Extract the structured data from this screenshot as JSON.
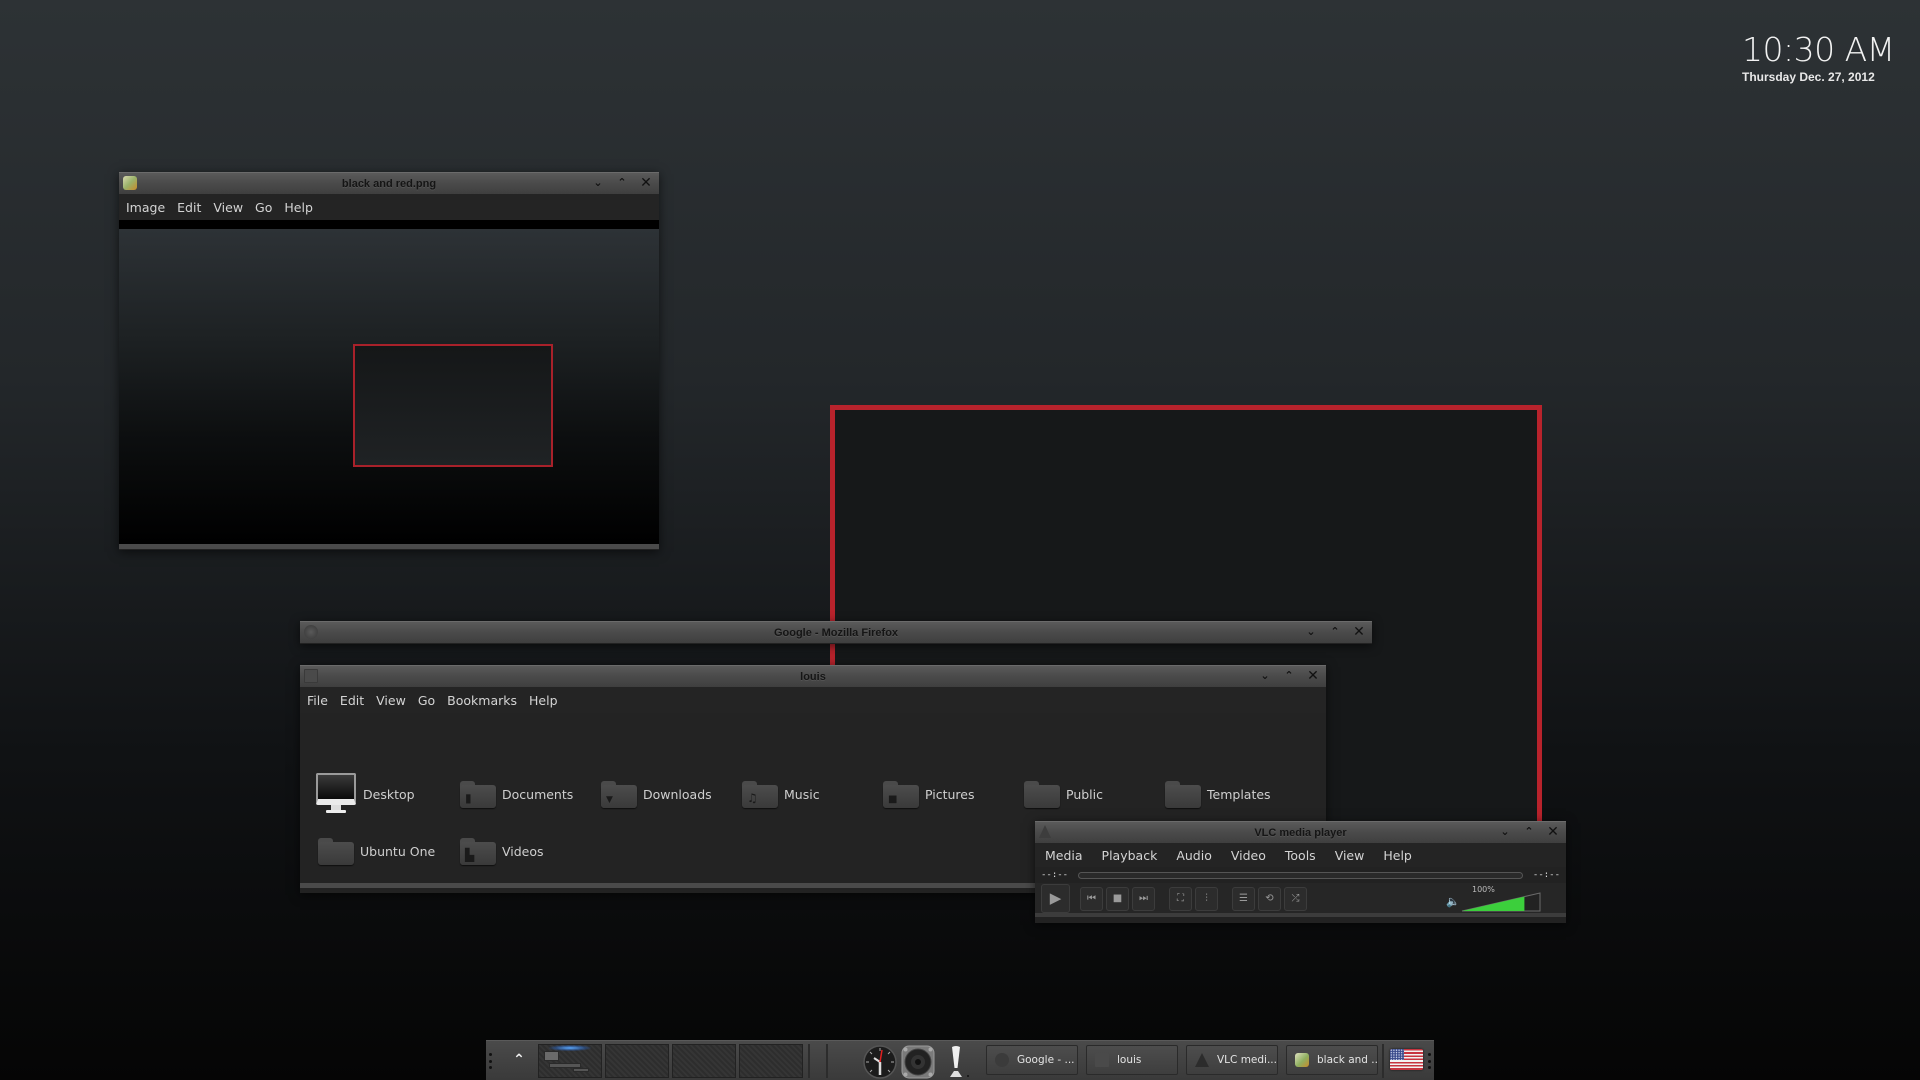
{
  "desktop": {
    "clock": {
      "time": "10:30 AM",
      "date": "Thursday Dec. 27, 2012"
    },
    "accent_red": "#b8232c"
  },
  "image_viewer": {
    "title": "black and red.png",
    "icon": "image-viewer-icon",
    "menu": [
      "Image",
      "Edit",
      "View",
      "Go",
      "Help"
    ],
    "controls": {
      "minimize": "⌄",
      "maximize": "⌃",
      "close": "✕"
    }
  },
  "firefox": {
    "title": "Google - Mozilla Firefox",
    "icon": "firefox-icon",
    "controls": {
      "minimize": "⌄",
      "maximize": "⌃",
      "close": "✕"
    }
  },
  "file_manager": {
    "title": "louis",
    "icon": "file-cabinet-icon",
    "menu": [
      "File",
      "Edit",
      "View",
      "Go",
      "Bookmarks",
      "Help"
    ],
    "controls": {
      "minimize": "⌄",
      "maximize": "⌃",
      "close": "✕"
    },
    "items": [
      {
        "label": "Desktop",
        "icon": "desktop-monitor-icon"
      },
      {
        "label": "Documents",
        "icon": "folder-documents-icon"
      },
      {
        "label": "Downloads",
        "icon": "folder-downloads-icon"
      },
      {
        "label": "Music",
        "icon": "folder-music-icon"
      },
      {
        "label": "Pictures",
        "icon": "folder-pictures-icon"
      },
      {
        "label": "Public",
        "icon": "folder-icon"
      },
      {
        "label": "Templates",
        "icon": "folder-icon"
      },
      {
        "label": "Ubuntu One",
        "icon": "folder-icon"
      },
      {
        "label": "Videos",
        "icon": "folder-videos-icon"
      }
    ]
  },
  "vlc": {
    "title": "VLC media player",
    "icon": "vlc-cone-icon",
    "menu": [
      "Media",
      "Playback",
      "Audio",
      "Video",
      "Tools",
      "View",
      "Help"
    ],
    "controls": {
      "minimize": "⌄",
      "maximize": "⌃",
      "close": "✕"
    },
    "elapsed": "--:--",
    "remaining": "--:--",
    "volume_label": "100%",
    "volume_fraction": 1.0,
    "volume_color": "#3ccf3c",
    "buttons": {
      "play": "▶",
      "prev": "⏮",
      "stop": "■",
      "next": "⏭",
      "fullscreen": "⛶",
      "extended": "⫶",
      "playlist": "☰",
      "loop": "⟲",
      "random": "⤮"
    }
  },
  "taskbar": {
    "show_desktop": "⌃",
    "workspaces": 4,
    "active_workspace": 0,
    "tasks": [
      {
        "label": "Google - ...",
        "icon": "firefox-icon"
      },
      {
        "label": "louis",
        "icon": "file-cabinet-icon"
      },
      {
        "label": "VLC medi...",
        "icon": "vlc-cone-icon"
      },
      {
        "label": "black and ...",
        "icon": "image-viewer-icon"
      }
    ],
    "keyboard_layout": "us-flag"
  }
}
